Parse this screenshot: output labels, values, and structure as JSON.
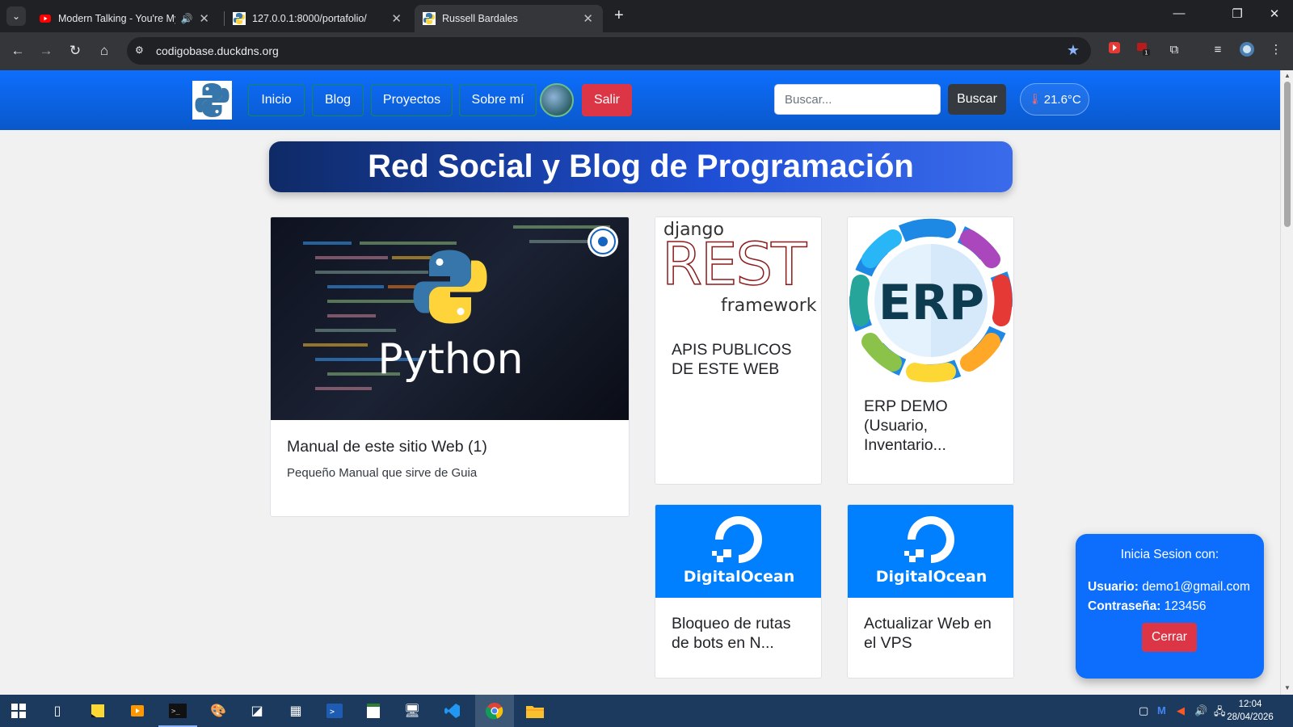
{
  "browser": {
    "tabs": [
      {
        "title": "Modern Talking - You're My",
        "active": false
      },
      {
        "title": "127.0.0.1:8000/portafolio/",
        "active": false
      },
      {
        "title": "Russell Bardales",
        "active": true
      }
    ],
    "url": "codigobase.duckdns.org"
  },
  "site": {
    "nav": {
      "links": [
        "Inicio",
        "Blog",
        "Proyectos",
        "Sobre mí"
      ],
      "logout": "Salir",
      "search_placeholder": "Buscar...",
      "search_button": "Buscar",
      "temperature": "21.6°C"
    },
    "hero_title": "Red Social y Blog de Programación",
    "cards": [
      {
        "title": "Manual de este sitio Web (1)",
        "text": "Pequeño Manual que sirve de Guia",
        "image_text": "Python"
      },
      {
        "title_lines": [
          "APIS PUBLICOS",
          "DE ESTE WEB"
        ],
        "image_text": [
          "django",
          "REST",
          "framework"
        ]
      },
      {
        "title_lines": [
          "ERP DEMO",
          "(Usuario,",
          "Inventario..."
        ],
        "image_text": "ERP"
      },
      {
        "title_lines": [
          "Bloqueo de rutas",
          "de bots en N..."
        ],
        "image_text": "DigitalOcean"
      },
      {
        "title_lines": [
          "Actualizar Web en",
          "el VPS"
        ],
        "image_text": "DigitalOcean"
      }
    ],
    "login_box": {
      "title": "Inicia Sesion con:",
      "user_label": "Usuario:",
      "user_value": "demo1@gmail.com",
      "password_label": "Contraseña:",
      "password_value": "123456",
      "close_button": "Cerrar"
    }
  },
  "taskbar": {
    "time": "12:04",
    "date": "28/04/2026"
  },
  "colors": {
    "primary": "#0d6efd",
    "danger": "#dc3545",
    "success_border": "#198754",
    "dark": "#343a40"
  }
}
